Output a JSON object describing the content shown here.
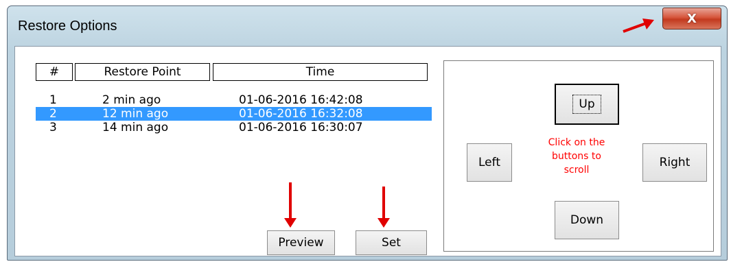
{
  "window": {
    "title": "Restore Options",
    "close_glyph": "X"
  },
  "list": {
    "columns": [
      "#",
      "Restore Point",
      "Time"
    ],
    "rows": [
      {
        "num": "1",
        "point": "2 min ago",
        "time": "01-06-2016 16:42:08",
        "selected": false
      },
      {
        "num": "2",
        "point": "12 min ago",
        "time": "01-06-2016 16:32:08",
        "selected": true
      },
      {
        "num": "3",
        "point": "14 min ago",
        "time": "01-06-2016 16:30:07",
        "selected": false
      }
    ]
  },
  "buttons": {
    "preview": "Preview",
    "set": "Set"
  },
  "nav": {
    "up": "Up",
    "down": "Down",
    "left": "Left",
    "right": "Right",
    "hint_line1": "Click on the",
    "hint_line2": "buttons to",
    "hint_line3": "scroll"
  },
  "colors": {
    "selection": "#3399ff",
    "hint": "#ff0000",
    "annotation_arrow": "#e00000"
  }
}
